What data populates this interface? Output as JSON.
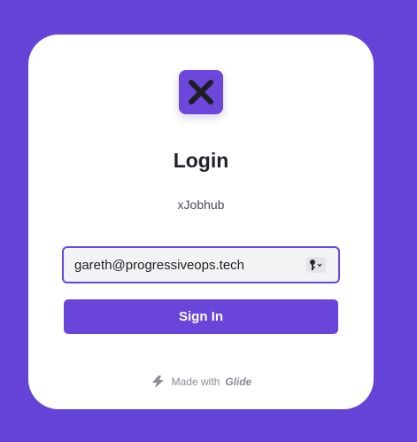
{
  "login": {
    "title": "Login",
    "app_name": "xJobhub",
    "email_value": "gareth@progressiveops.tech",
    "sign_in_label": "Sign In"
  },
  "footer": {
    "made_with_label": "Made with",
    "brand": "Glide"
  },
  "icons": {
    "app_logo": "x-logo-icon",
    "password_manager": "key-icon",
    "glide_logo": "glide-bolt-icon"
  },
  "colors": {
    "background": "#6543d6",
    "accent": "#6a45d9",
    "card": "#ffffff"
  }
}
